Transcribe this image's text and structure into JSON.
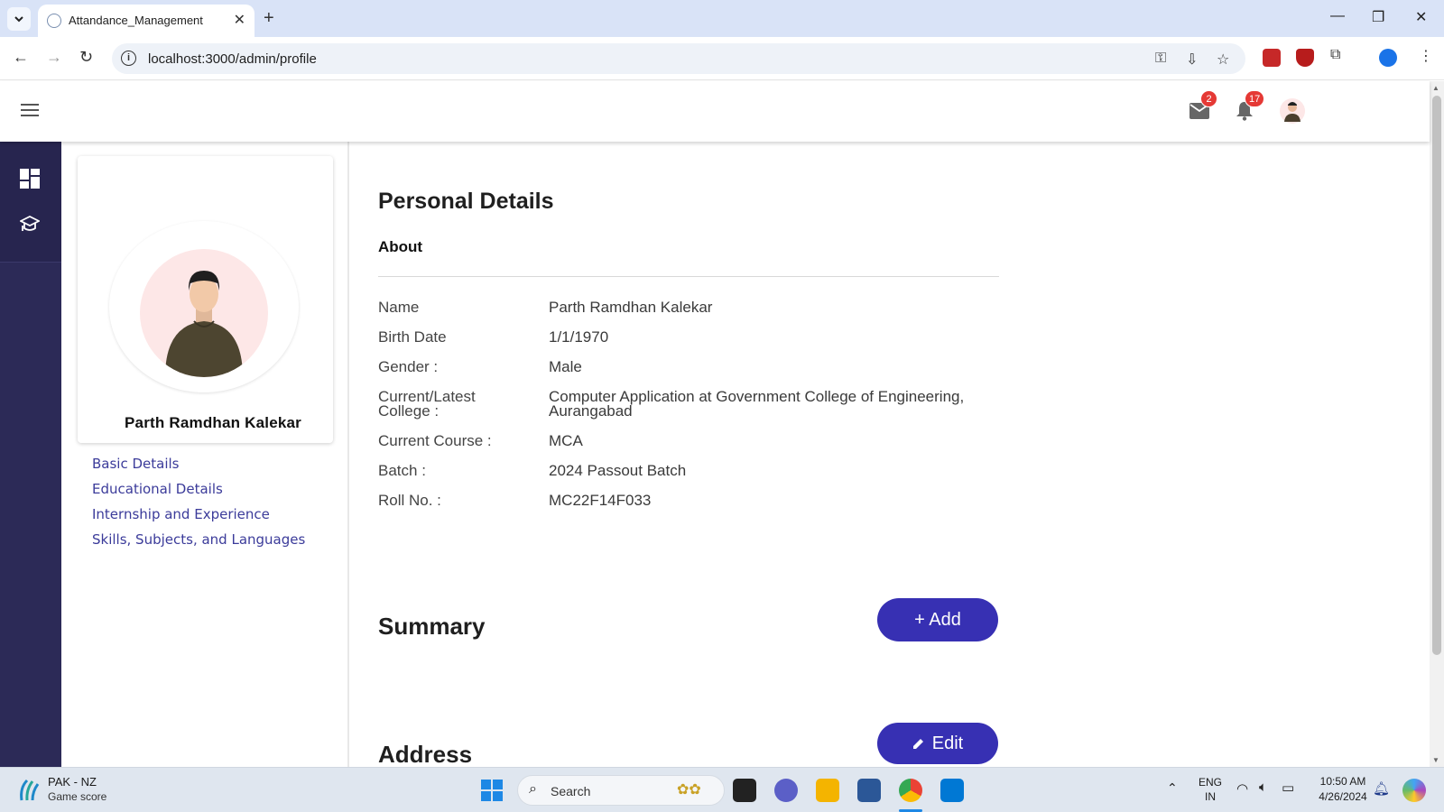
{
  "browser": {
    "tab_title": "Attandance_Management",
    "url": "localhost:3000/admin/profile"
  },
  "header": {
    "mail_count": "2",
    "notification_count": "17"
  },
  "profile": {
    "name": "Parth Ramdhan Kalekar",
    "links": [
      "Basic Details",
      "Educational Details",
      "Internship and Experience",
      "Skills, Subjects, and Languages"
    ]
  },
  "personal": {
    "title": "Personal Details",
    "about_label": "About",
    "rows": [
      {
        "label": "Name",
        "value": "Parth Ramdhan Kalekar"
      },
      {
        "label": "Birth Date",
        "value": "1/1/1970"
      },
      {
        "label": "Gender :",
        "value": "Male"
      },
      {
        "label": "Current/Latest College :",
        "value": "Computer Application at Government College of Engineering, Aurangabad"
      },
      {
        "label": "Current Course :",
        "value": "MCA"
      },
      {
        "label": "Batch :",
        "value": "2024 Passout Batch"
      },
      {
        "label": "Roll No. :",
        "value": "MC22F14F033"
      }
    ]
  },
  "summary": {
    "title": "Summary",
    "add_label": "+ Add"
  },
  "address": {
    "title": "Address",
    "edit_label": "Edit"
  },
  "taskbar": {
    "weather_title": "PAK - NZ",
    "weather_sub": "Game score",
    "search_label": "Search",
    "lang_top": "ENG",
    "lang_bottom": "IN",
    "time": "10:50 AM",
    "date": "4/26/2024"
  },
  "colors": {
    "rail": "#2c2a57",
    "primary_button": "#3730b3",
    "link": "#3b3b9a",
    "badge": "#e53935"
  }
}
